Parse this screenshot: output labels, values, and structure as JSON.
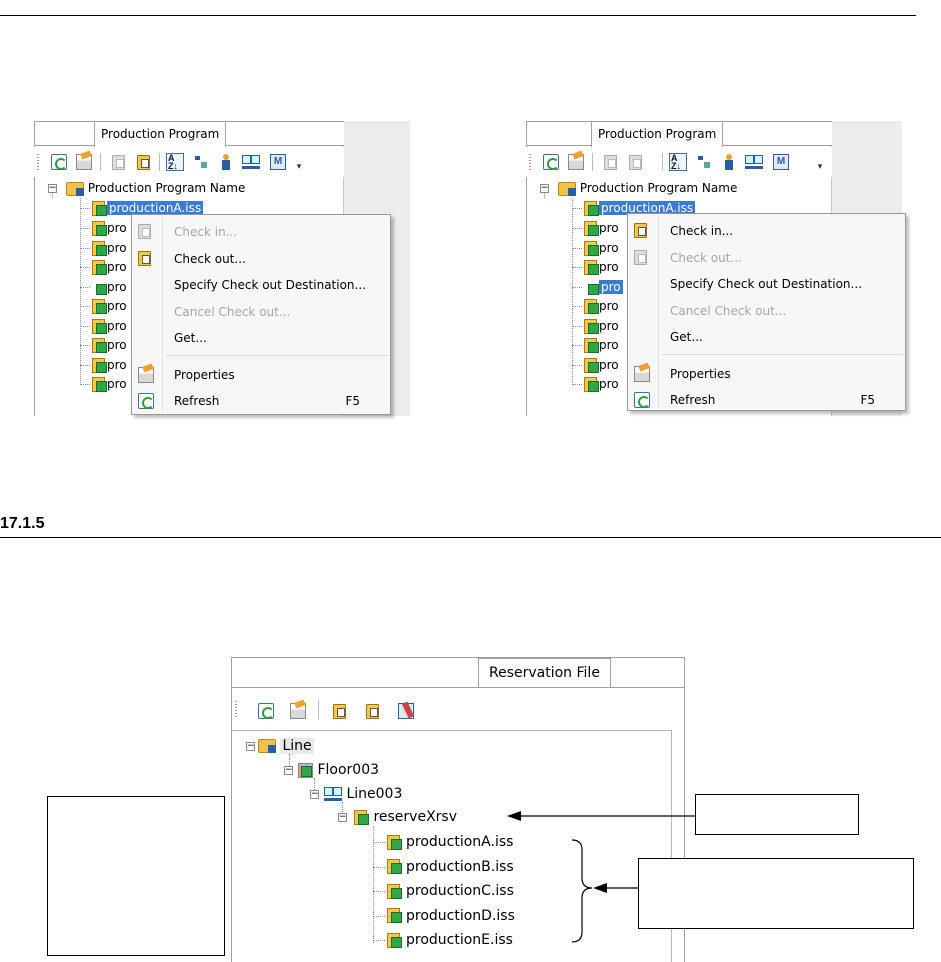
{
  "section": {
    "number": "17.1.5"
  },
  "top_left": {
    "tab": "Production Program",
    "tree": {
      "root": "Production Program Name",
      "selected": "productionA.iss",
      "items": [
        "pro",
        "pro",
        "pro",
        "pro",
        "pro",
        "pro",
        "pro",
        "pro",
        "pro"
      ]
    },
    "menu": [
      {
        "label": "Check in...",
        "disabled": true,
        "icon": "check-in-icon"
      },
      {
        "label": "Check out...",
        "disabled": false,
        "icon": "check-out-icon"
      },
      {
        "label": "Specify Check out Destination...",
        "disabled": false,
        "icon": ""
      },
      {
        "label": "Cancel Check out...",
        "disabled": true,
        "icon": ""
      },
      {
        "label": "Get...",
        "disabled": false,
        "icon": ""
      },
      {
        "label": "Properties",
        "disabled": false,
        "icon": "properties-icon"
      },
      {
        "label": "Refresh",
        "disabled": false,
        "icon": "refresh-icon",
        "shortcut": "F5"
      }
    ]
  },
  "top_right": {
    "tab": "Production Program",
    "tree": {
      "root": "Production Program Name",
      "selected": "productionA.iss",
      "items": [
        "pro",
        "pro",
        "pro",
        "pro",
        "pro",
        "pro",
        "pro",
        "pro",
        "pro"
      ]
    },
    "menu": [
      {
        "label": "Check in...",
        "disabled": false,
        "icon": "check-in-icon"
      },
      {
        "label": "Check out...",
        "disabled": true,
        "icon": "check-out-icon"
      },
      {
        "label": "Specify Check out Destination...",
        "disabled": false,
        "icon": ""
      },
      {
        "label": "Cancel Check out...",
        "disabled": true,
        "icon": ""
      },
      {
        "label": "Get...",
        "disabled": false,
        "icon": ""
      },
      {
        "label": "Properties",
        "disabled": false,
        "icon": "properties-icon"
      },
      {
        "label": "Refresh",
        "disabled": false,
        "icon": "refresh-icon",
        "shortcut": "F5"
      }
    ]
  },
  "bottom": {
    "tab": "Reservation File",
    "tree": {
      "line": "Line",
      "floor": "Floor003",
      "line2": "Line003",
      "reserve": "reserveXrsv",
      "files": [
        "productionA.iss",
        "productionB.iss",
        "productionC.iss",
        "productionD.iss",
        "productionE.iss"
      ]
    }
  }
}
